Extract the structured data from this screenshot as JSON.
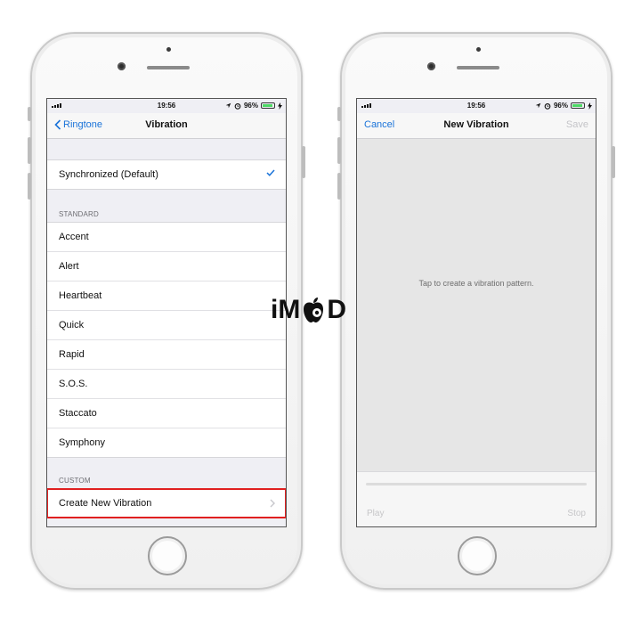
{
  "status_bar": {
    "time": "19:56",
    "battery": "96%"
  },
  "left_screen": {
    "back_label": "Ringtone",
    "title": "Vibration",
    "default_item": "Synchronized (Default)",
    "standard_header": "STANDARD",
    "standard_items": [
      "Accent",
      "Alert",
      "Heartbeat",
      "Quick",
      "Rapid",
      "S.O.S.",
      "Staccato",
      "Symphony"
    ],
    "custom_header": "CUSTOM",
    "custom_item": "Create New Vibration"
  },
  "right_screen": {
    "cancel_label": "Cancel",
    "title": "New Vibration",
    "save_label": "Save",
    "hint": "Tap to create a vibration pattern.",
    "play_label": "Play",
    "stop_label": "Stop"
  },
  "logo": {
    "left": "iM",
    "right": "D"
  },
  "colors": {
    "accent": "#1a73d9",
    "highlight": "#e02020",
    "battery": "#4cd964"
  }
}
